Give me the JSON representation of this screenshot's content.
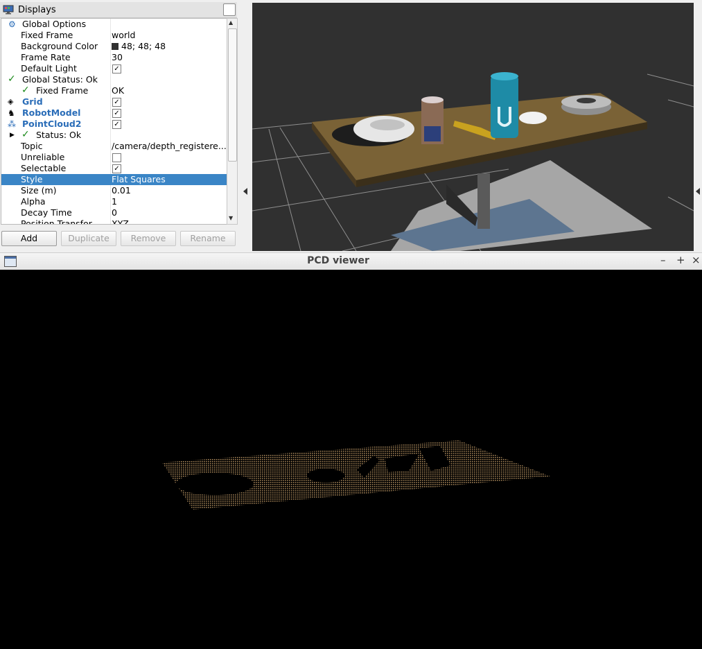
{
  "displays": {
    "title": "Displays",
    "rows": [
      {
        "name": "Global Options",
        "value": ""
      },
      {
        "name": "Fixed Frame",
        "value": "world"
      },
      {
        "name": "Background Color",
        "value": "48; 48; 48"
      },
      {
        "name": "Frame Rate",
        "value": "30"
      },
      {
        "name": "Default Light",
        "value": ""
      },
      {
        "name": "Global Status: Ok",
        "value": ""
      },
      {
        "name": "Fixed Frame",
        "value": "OK"
      },
      {
        "name": "Grid",
        "value": ""
      },
      {
        "name": "RobotModel",
        "value": ""
      },
      {
        "name": "PointCloud2",
        "value": ""
      },
      {
        "name": "Status: Ok",
        "value": ""
      },
      {
        "name": "Topic",
        "value": "/camera/depth_registere..."
      },
      {
        "name": "Unreliable",
        "value": ""
      },
      {
        "name": "Selectable",
        "value": ""
      },
      {
        "name": "Style",
        "value": "Flat Squares"
      },
      {
        "name": "Size (m)",
        "value": "0.01"
      },
      {
        "name": "Alpha",
        "value": "1"
      },
      {
        "name": "Decay Time",
        "value": "0"
      },
      {
        "name": "Position Transfor...",
        "value": "XYZ"
      }
    ],
    "checkboxes": {
      "default_light": true,
      "grid": true,
      "robot_model": true,
      "pointcloud2": true,
      "unreliable": false,
      "selectable": true
    },
    "background_color_hex": "#303030",
    "buttons": {
      "add": "Add",
      "duplicate": "Duplicate",
      "remove": "Remove",
      "rename": "Rename"
    }
  },
  "pcd_viewer": {
    "title": "PCD viewer",
    "minimize": "–",
    "maximize": "+",
    "close": "×"
  },
  "colors": {
    "selection": "#3a85c6",
    "display_name_blue": "#2a6db8",
    "status_green": "#1b8a1b"
  }
}
